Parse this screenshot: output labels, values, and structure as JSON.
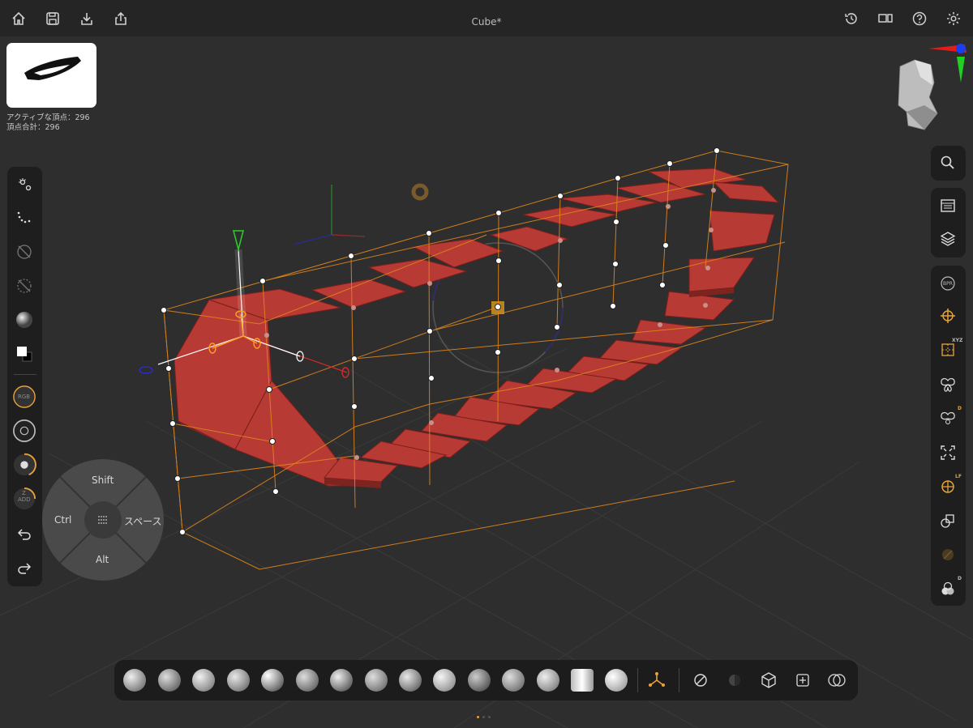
{
  "app": {
    "document_title": "Cube*"
  },
  "stats": {
    "active_vertices": "アクティブな頂点：296",
    "total_vertices": "頂点合計：296"
  },
  "modifier_pad": {
    "shift": "Shift",
    "ctrl": "Ctrl",
    "space": "スペース",
    "alt": "Alt"
  },
  "left_tools": [
    "select-points-icon",
    "select-loop-icon",
    "mask-off-icon",
    "mask-grid-off-icon",
    "material-sphere-icon",
    "color-swatch-icon",
    "rgb-mode",
    "stroke-icon",
    "draw-intensity",
    "z-add",
    "undo-icon",
    "redo-icon"
  ],
  "left_labels": {
    "rgb": "RGB",
    "zadd_z": "Z",
    "zadd": "ADD",
    "c": "C"
  },
  "right_labels": {
    "bpr": "BPR",
    "xyz": "XYZ",
    "d1": "D",
    "lf": "LF",
    "d2": "D"
  },
  "colors": {
    "accent": "#e8a23a",
    "mesh": "#b83a34",
    "cage": "#e0861c"
  },
  "bottom_brushes": [
    "clay-buildup",
    "move-topological",
    "standard",
    "claybuildup-2",
    "inflate",
    "dam-standard",
    "snakehook",
    "trim-dynamic",
    "pinch",
    "smooth",
    "move",
    "hpolish",
    "chisel",
    "imm-parts",
    "curve"
  ],
  "page_indicator": {
    "current": 1,
    "total": 3
  }
}
